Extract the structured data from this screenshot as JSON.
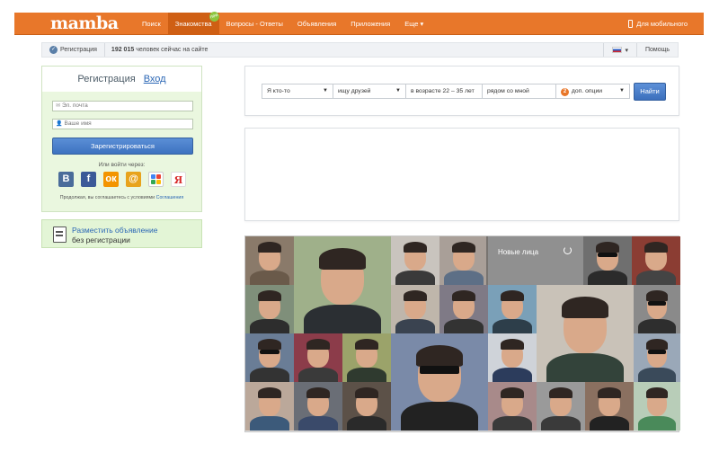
{
  "topbar": {
    "logo": "mamba",
    "nav": [
      {
        "label": "Поиск"
      },
      {
        "label": "Знакомства",
        "active": true,
        "badge": "new"
      },
      {
        "label": "Вопросы - Ответы"
      },
      {
        "label": "Объявления"
      },
      {
        "label": "Приложения"
      },
      {
        "label": "Еще"
      }
    ],
    "mobile": "Для мобильного"
  },
  "subbar": {
    "registration": "Регистрация",
    "online_count": "192 015",
    "online_text": "человек сейчас на сайте",
    "help": "Помощь"
  },
  "reg_card": {
    "tab_register": "Регистрация",
    "tab_login": "Вход",
    "email_placeholder": "Эл. почта",
    "name_placeholder": "Ваше имя",
    "submit": "Зарегистрироваться",
    "or_via": "Или войти через:",
    "socials": [
      {
        "name": "vk",
        "glyph": "В"
      },
      {
        "name": "facebook",
        "glyph": "f"
      },
      {
        "name": "odnoklassniki",
        "glyph": "ок"
      },
      {
        "name": "mail",
        "glyph": "@"
      },
      {
        "name": "google",
        "glyph": ""
      },
      {
        "name": "yandex",
        "glyph": "Я"
      }
    ],
    "terms_text": "Продолжая, вы соглашаетесь с условиями",
    "terms_link": "Соглашения"
  },
  "ad_card": {
    "link": "Разместить объявление",
    "sub": "без регистрации"
  },
  "search": {
    "who": "Я кто-то",
    "seeking": "ищу друзей",
    "age": "в возрасте 22 – 35 лет",
    "location": "рядом со мной",
    "options_count": "2",
    "options_label": "доп. опции",
    "submit": "Найти"
  },
  "photos": {
    "new_faces": "Новые лица"
  },
  "colors": {
    "brand_orange": "#e8772a",
    "button_blue": "#3d72c0",
    "reg_green": "#eaf7df"
  }
}
